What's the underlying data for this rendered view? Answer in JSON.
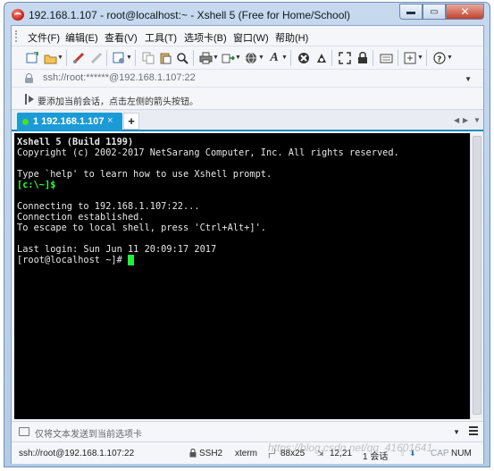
{
  "window": {
    "title": "192.168.1.107 - root@localhost:~ - Xshell 5 (Free for Home/School)",
    "minimize_icon": "▬",
    "restore_icon": "▭",
    "close_icon": "✕"
  },
  "menu": {
    "items": [
      "文件(F)",
      "编辑(E)",
      "查看(V)",
      "工具(T)",
      "选项卡(B)",
      "窗口(W)",
      "帮助(H)"
    ]
  },
  "toolbar": {
    "icons": [
      "new-session-icon",
      "open-folder-icon",
      "connect-icon",
      "disconnect-icon",
      "properties-icon",
      "copy-icon",
      "paste-icon",
      "find-icon",
      "print-icon",
      "transfer-icon",
      "globe-icon",
      "font-icon",
      "xftp-icon",
      "stop-icon",
      "fullscreen-icon",
      "lock-icon",
      "keyboard-icon",
      "compose-icon",
      "help-icon"
    ]
  },
  "address": {
    "value": "ssh://root:******@192.168.1.107:22"
  },
  "hint": {
    "text": "要添加当前会话，点击左侧的箭头按钮。"
  },
  "tabs": {
    "active_label": "1 192.168.1.107",
    "close_glyph": "×",
    "add_glyph": "+"
  },
  "terminal": {
    "lines": [
      "Xshell 5 (Build 1199)",
      "Copyright (c) 2002-2017 NetSarang Computer, Inc. All rights reserved.",
      "",
      "Type `help' to learn how to use Xshell prompt.",
      "[c:\\~]$",
      "",
      "Connecting to 192.168.1.107:22...",
      "Connection established.",
      "To escape to local shell, press 'Ctrl+Alt+]'.",
      "",
      "Last login: Sun Jun 11 20:09:17 2017",
      "[root@localhost ~]# "
    ]
  },
  "sendbar": {
    "placeholder": "仅将文本发送到当前选项卡"
  },
  "status": {
    "connection": "ssh://root@192.168.1.107:22",
    "protocol": "SSH2",
    "terminal_type": "xterm",
    "size": "88x25",
    "cursor_pos": "12,21",
    "sessions": "1 会话",
    "caps": "CAP",
    "num": "NUM"
  },
  "watermark": "https://blog.csdn.net/qq_41601641"
}
